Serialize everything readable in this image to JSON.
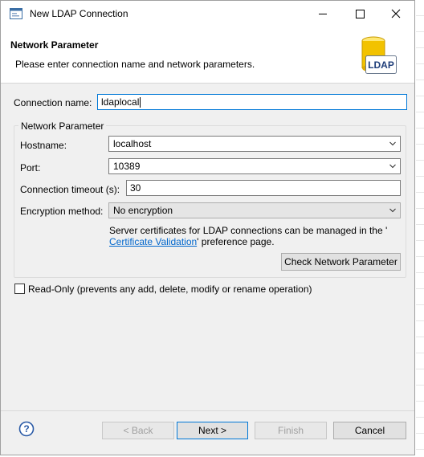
{
  "window": {
    "title": "New LDAP Connection"
  },
  "banner": {
    "title": "Network Parameter",
    "subtitle": "Please enter connection name and network parameters.",
    "logo_text": "LDAP"
  },
  "form": {
    "connection_name_label": "Connection name:",
    "connection_name_value": "ldaplocal",
    "group_title": "Network Parameter",
    "hostname_label": "Hostname:",
    "hostname_value": "localhost",
    "port_label": "Port:",
    "port_value": "10389",
    "timeout_label": "Connection timeout (s):",
    "timeout_value": "30",
    "encryption_label": "Encryption method:",
    "encryption_value": "No encryption",
    "info_text_1": "Server certificates for LDAP connections can be managed in the '",
    "info_link": "Certificate Validation",
    "info_text_2": "' preference page.",
    "check_button": "Check Network Parameter",
    "readonly_label": "Read-Only (prevents any add, delete, modify or rename operation)"
  },
  "footer": {
    "back": "< Back",
    "next": "Next >",
    "finish": "Finish",
    "cancel": "Cancel"
  },
  "colors": {
    "accent": "#0078d7",
    "link": "#0066cc",
    "logo_cylinder": "#f2c200"
  }
}
